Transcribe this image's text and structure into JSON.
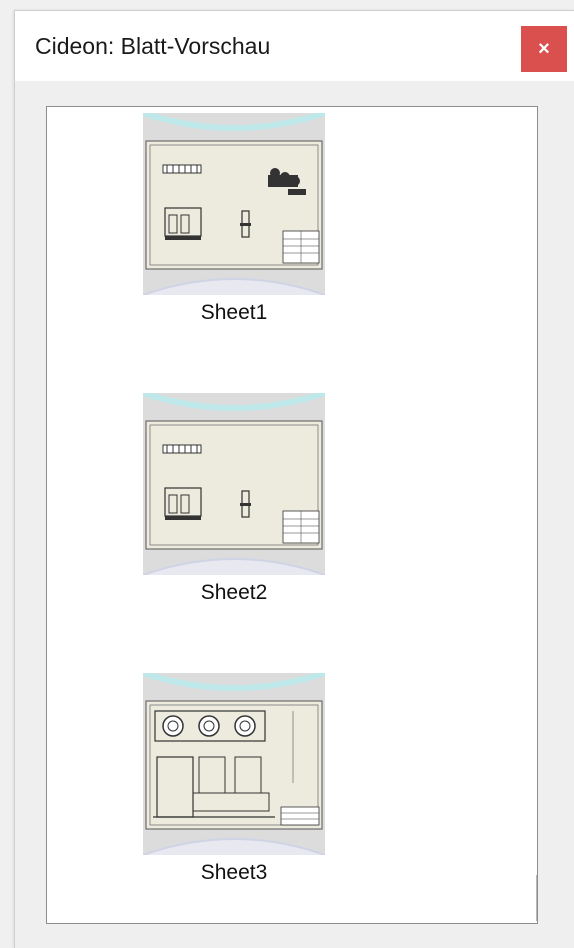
{
  "window": {
    "title": "Cideon: Blatt-Vorschau",
    "close_label": "×",
    "close_color": "#d9504e"
  },
  "sheets": [
    {
      "label": "Sheet1"
    },
    {
      "label": "Sheet2"
    },
    {
      "label": "Sheet3"
    }
  ]
}
